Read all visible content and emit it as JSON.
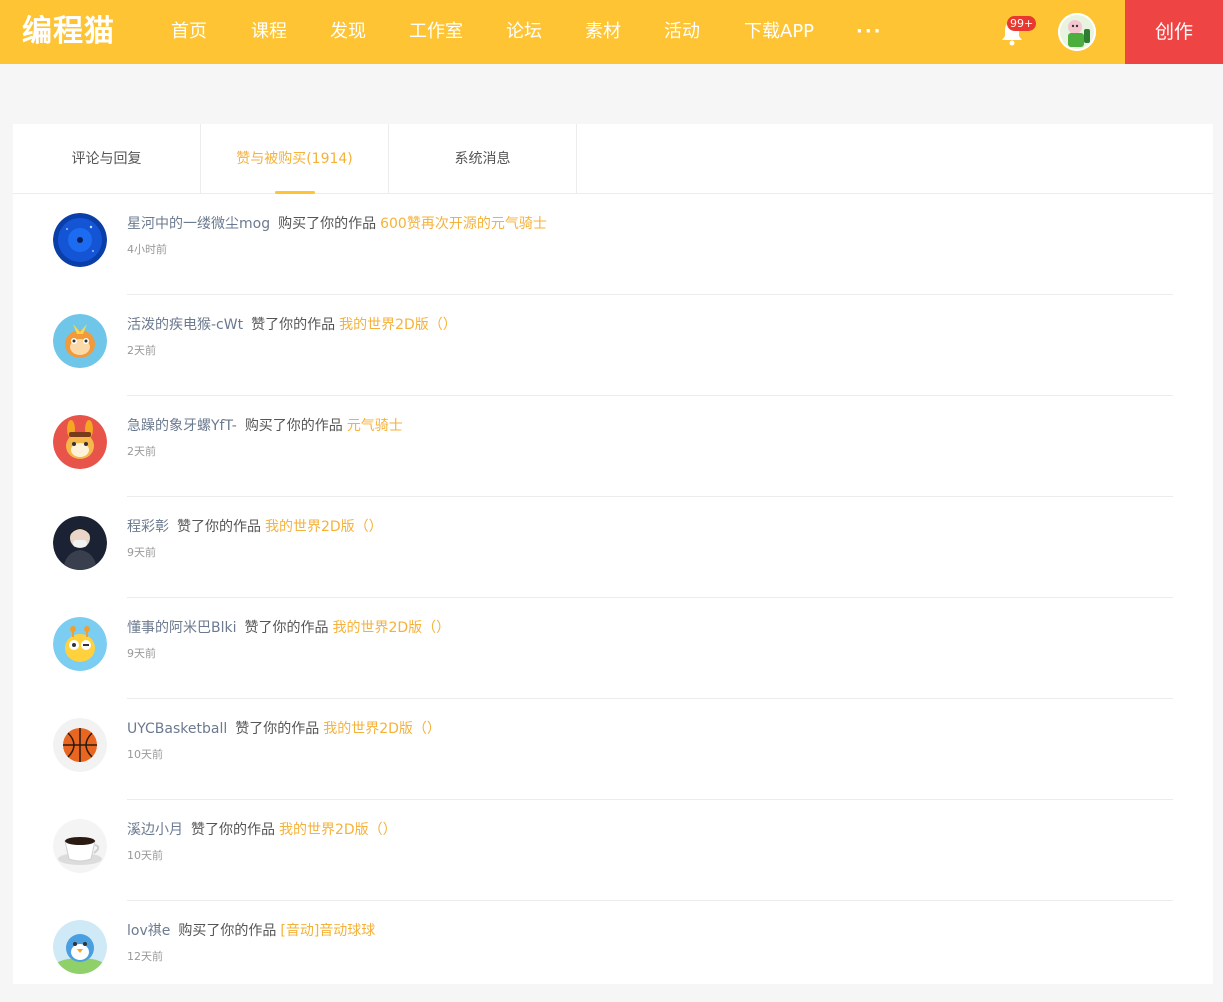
{
  "header": {
    "logo": "编程猫",
    "nav": [
      {
        "label": "首页"
      },
      {
        "label": "课程"
      },
      {
        "label": "发现"
      },
      {
        "label": "工作室"
      },
      {
        "label": "论坛"
      },
      {
        "label": "素材"
      },
      {
        "label": "活动"
      },
      {
        "label": "下载APP"
      }
    ],
    "more": "···",
    "notification_badge": "99+",
    "create_label": "创作"
  },
  "tabs": [
    {
      "label": "评论与回复",
      "active": false
    },
    {
      "label": "赞与被购买(1914)",
      "active": true
    },
    {
      "label": "系统消息",
      "active": false
    }
  ],
  "messages": [
    {
      "user": "星河中的一缕微尘mog",
      "action": "购买了你的作品",
      "work": "600赞再次开源的元气骑士",
      "time": "4小时前",
      "avatar": "blue-sphere"
    },
    {
      "user": "活泼的疾电猴-cWt",
      "action": "赞了你的作品",
      "work": "我的世界2D版（）",
      "time": "2天前",
      "avatar": "monkey"
    },
    {
      "user": "急躁的象牙螺YfT-",
      "action": "购买了你的作品",
      "work": "元气骑士",
      "time": "2天前",
      "avatar": "rabbit"
    },
    {
      "user": "程彩彰",
      "action": "赞了你的作品",
      "work": "我的世界2D版（）",
      "time": "9天前",
      "avatar": "person"
    },
    {
      "user": "懂事的阿米巴Blki",
      "action": "赞了你的作品",
      "work": "我的世界2D版（）",
      "time": "9天前",
      "avatar": "giraffe"
    },
    {
      "user": "UYCBasketball",
      "action": "赞了你的作品",
      "work": "我的世界2D版（）",
      "time": "10天前",
      "avatar": "basketball"
    },
    {
      "user": "溪边小月",
      "action": "赞了你的作品",
      "work": "我的世界2D版（）",
      "time": "10天前",
      "avatar": "coffee"
    },
    {
      "user": "lov祺e",
      "action": "购买了你的作品",
      "work": "[音动]音动球球",
      "time": "12天前",
      "avatar": "bird"
    }
  ]
}
